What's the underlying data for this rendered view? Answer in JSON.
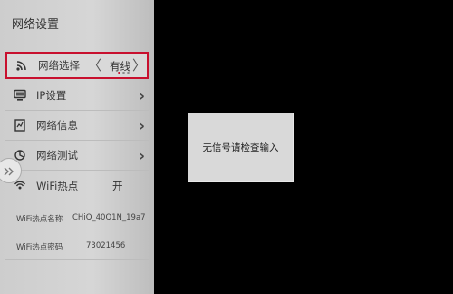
{
  "panel": {
    "title": "网络设置",
    "items": [
      {
        "label": "网络选择",
        "icon": "wifi-icon",
        "value": "有线"
      },
      {
        "label": "IP设置",
        "icon": "monitor-icon",
        "chevron": "›"
      },
      {
        "label": "网络信息",
        "icon": "document-icon",
        "chevron": "›"
      },
      {
        "label": "网络测试",
        "icon": "network-test-icon",
        "chevron": "›"
      },
      {
        "label": "WiFi热点",
        "icon": "hotspot-icon",
        "value": "开"
      }
    ],
    "selector": {
      "left_arrow": "〈",
      "right_arrow": "〉"
    },
    "hotspot_name_label": "WiFi热点名称",
    "hotspot_name_value": "CHiQ_40Q1N_19a7",
    "hotspot_password_label": "WiFi热点密码",
    "hotspot_password_value": "73021456"
  },
  "dialog": {
    "message": "无信号请检查输入"
  },
  "colors": {
    "selection_border": "#c8102e",
    "background": "#000000",
    "panel": "#d4d4d4"
  }
}
